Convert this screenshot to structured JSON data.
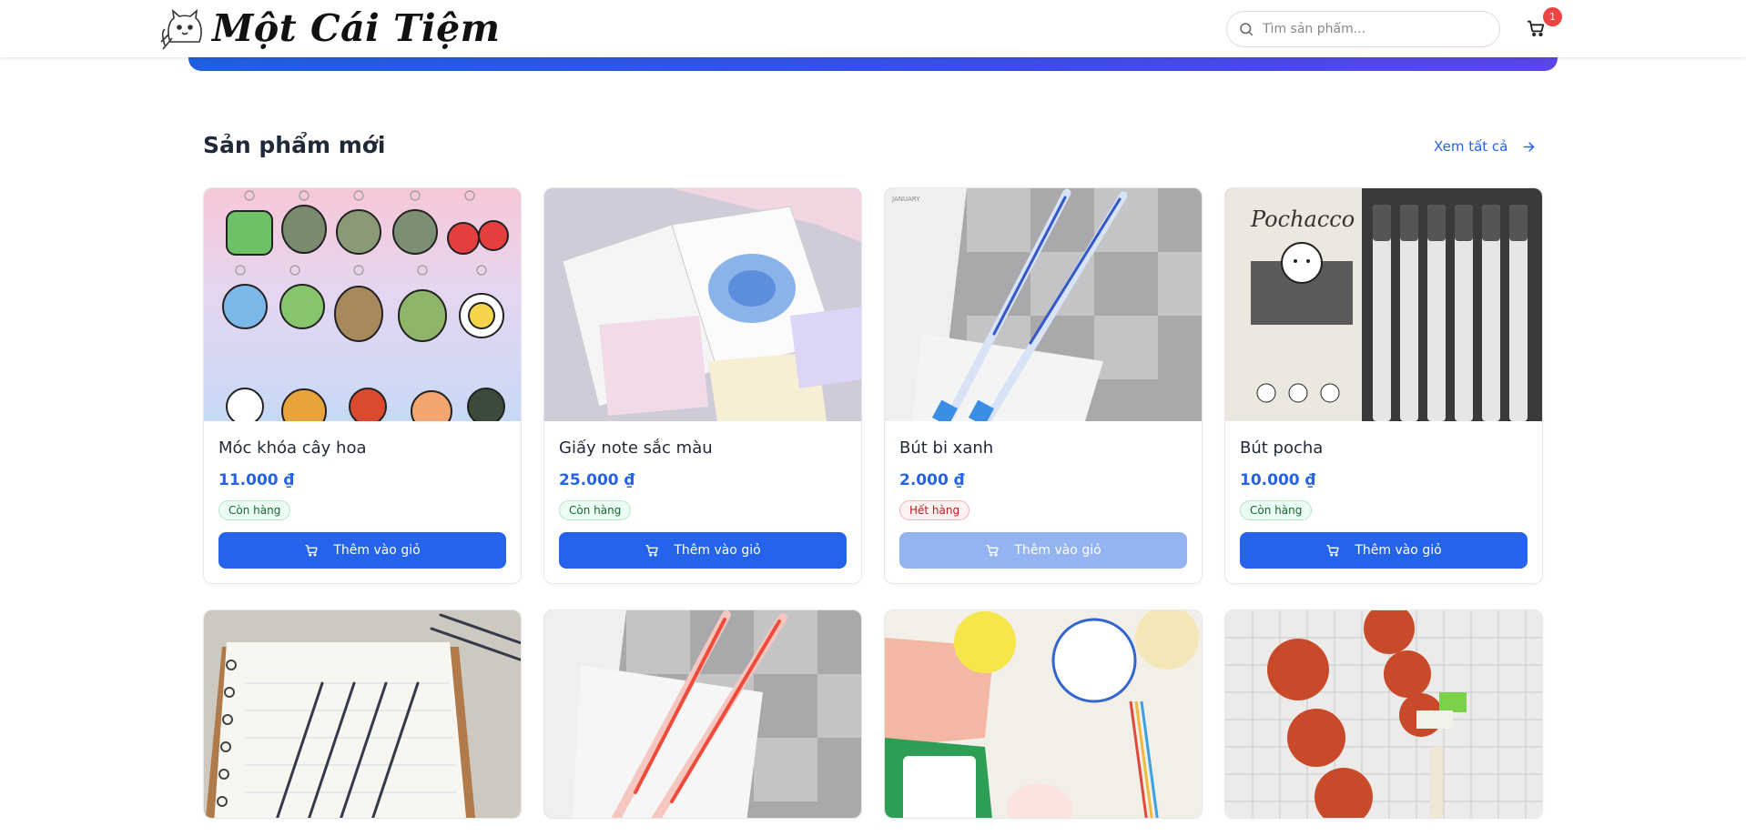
{
  "header": {
    "logo_text": "Một Cái Tiệm",
    "search_placeholder": "Tìm sản phẩm...",
    "cart_count": "1"
  },
  "section": {
    "title": "Sản phẩm mới",
    "see_all": "Xem tất cả"
  },
  "products": [
    {
      "name": "Móc khóa cây hoa",
      "price": "11.000 ₫",
      "status": "Còn hàng",
      "in_stock": true,
      "button": "Thêm vào giỏ"
    },
    {
      "name": "Giấy note sắc màu",
      "price": "25.000 ₫",
      "status": "Còn hàng",
      "in_stock": true,
      "button": "Thêm vào giỏ"
    },
    {
      "name": "Bút bi xanh",
      "price": "2.000 ₫",
      "status": "Hết hàng",
      "in_stock": false,
      "button": "Thêm vào giỏ"
    },
    {
      "name": "Bút pocha",
      "price": "10.000 ₫",
      "status": "Còn hàng",
      "in_stock": true,
      "button": "Thêm vào giỏ"
    }
  ],
  "colors": {
    "accent": "#2563eb",
    "accent_disabled": "#93b4f0",
    "badge_red": "#ef4444"
  },
  "icons": {
    "search": "search-icon",
    "cart": "cart-icon",
    "arrow": "arrow-right-icon"
  }
}
